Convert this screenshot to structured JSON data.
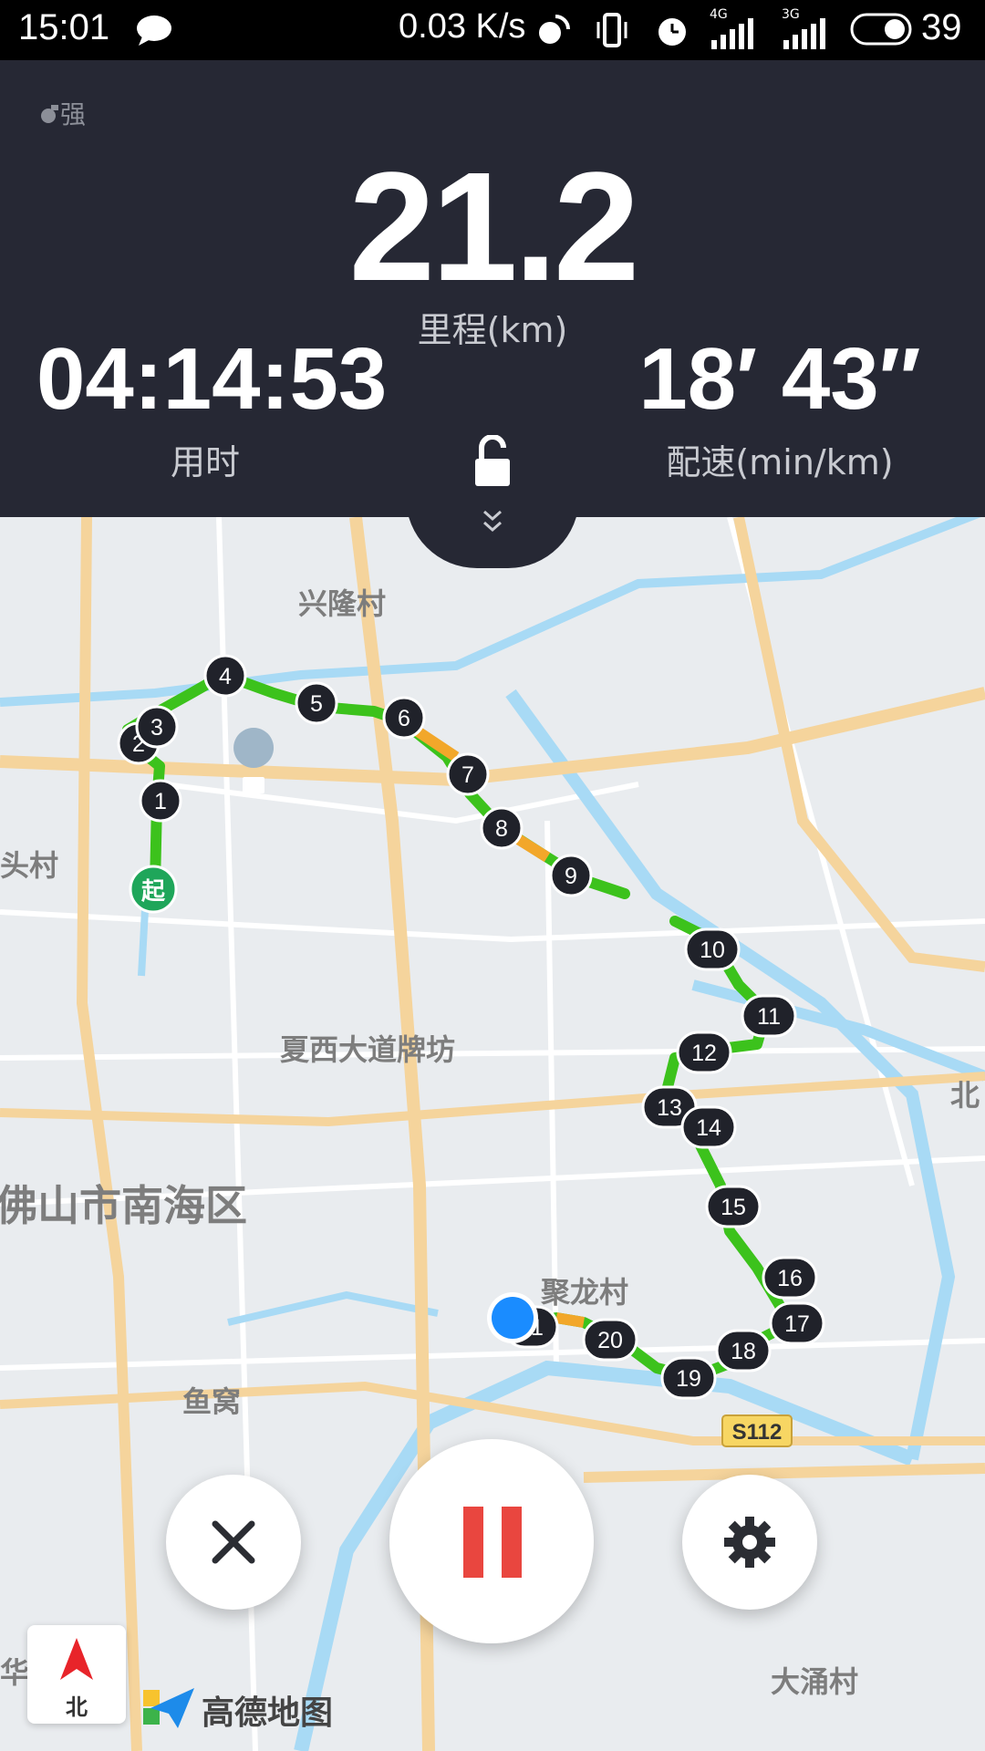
{
  "status_bar": {
    "time": "15:01",
    "net_speed": "0.03 K/s",
    "sig4g": "4G",
    "sig3g": "3G",
    "battery": "39"
  },
  "header": {
    "gps_label": "强",
    "distance_value": "21.2",
    "distance_label": "里程(km)",
    "time_value": "04:14:53",
    "time_label": "用时",
    "pace_value": "18′ 43″",
    "pace_label": "配速(min/km)"
  },
  "map": {
    "places": [
      "兴隆村",
      "头村",
      "夏西大道牌坊",
      "佛山市南海区",
      "聚龙村",
      "鱼窝",
      "北",
      "华",
      "大涌村"
    ],
    "road_badge": "S112",
    "start_marker": "起",
    "km_markers": [
      "1",
      "2",
      "3",
      "4",
      "5",
      "6",
      "7",
      "8",
      "9",
      "10",
      "11",
      "12",
      "13",
      "14",
      "15",
      "16",
      "17",
      "18",
      "19",
      "20",
      "21"
    ],
    "logo_text": "高德地图",
    "compass_label": "北"
  },
  "colors": {
    "header_bg": "#262834",
    "pause_red": "#e9463f",
    "route_green": "#3cc21c",
    "start_green": "#1fa65a",
    "position_blue": "#1a8cff"
  }
}
